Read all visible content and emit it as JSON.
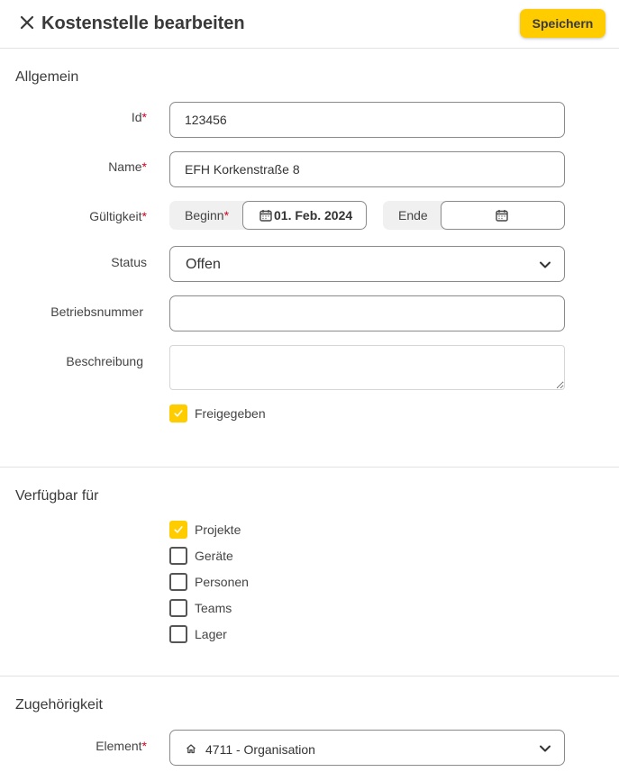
{
  "header": {
    "title": "Kostenstelle bearbeiten",
    "save_label": "Speichern"
  },
  "general": {
    "section_title": "Allgemein",
    "id": {
      "label": "Id",
      "required": "*",
      "value": "123456"
    },
    "name": {
      "label": "Name",
      "required": "*",
      "value": "EFH Korkenstraße 8"
    },
    "validity": {
      "label": "Gültigkeit",
      "required": "*",
      "begin_label": "Beginn",
      "begin_required": "*",
      "begin_value": "01. Feb. 2024",
      "end_label": "Ende",
      "end_value": ""
    },
    "status": {
      "label": "Status",
      "value": "Offen"
    },
    "company_number": {
      "label": "Betriebsnummer",
      "value": ""
    },
    "description": {
      "label": "Beschreibung",
      "value": ""
    },
    "released": {
      "label": "Freigegeben",
      "checked": true
    }
  },
  "available_for": {
    "section_title": "Verfügbar für",
    "items": [
      {
        "label": "Projekte",
        "checked": true
      },
      {
        "label": "Geräte",
        "checked": false
      },
      {
        "label": "Personen",
        "checked": false
      },
      {
        "label": "Teams",
        "checked": false
      },
      {
        "label": "Lager",
        "checked": false
      }
    ]
  },
  "affiliation": {
    "section_title": "Zugehörigkeit",
    "element": {
      "label": "Element",
      "required": "*",
      "value": "4711 - Organisation",
      "icon": "home-icon"
    }
  },
  "colors": {
    "accent": "#ffcc00",
    "required": "#d0021b",
    "border": "#8a8a8a",
    "divider": "#e2e2e2"
  }
}
